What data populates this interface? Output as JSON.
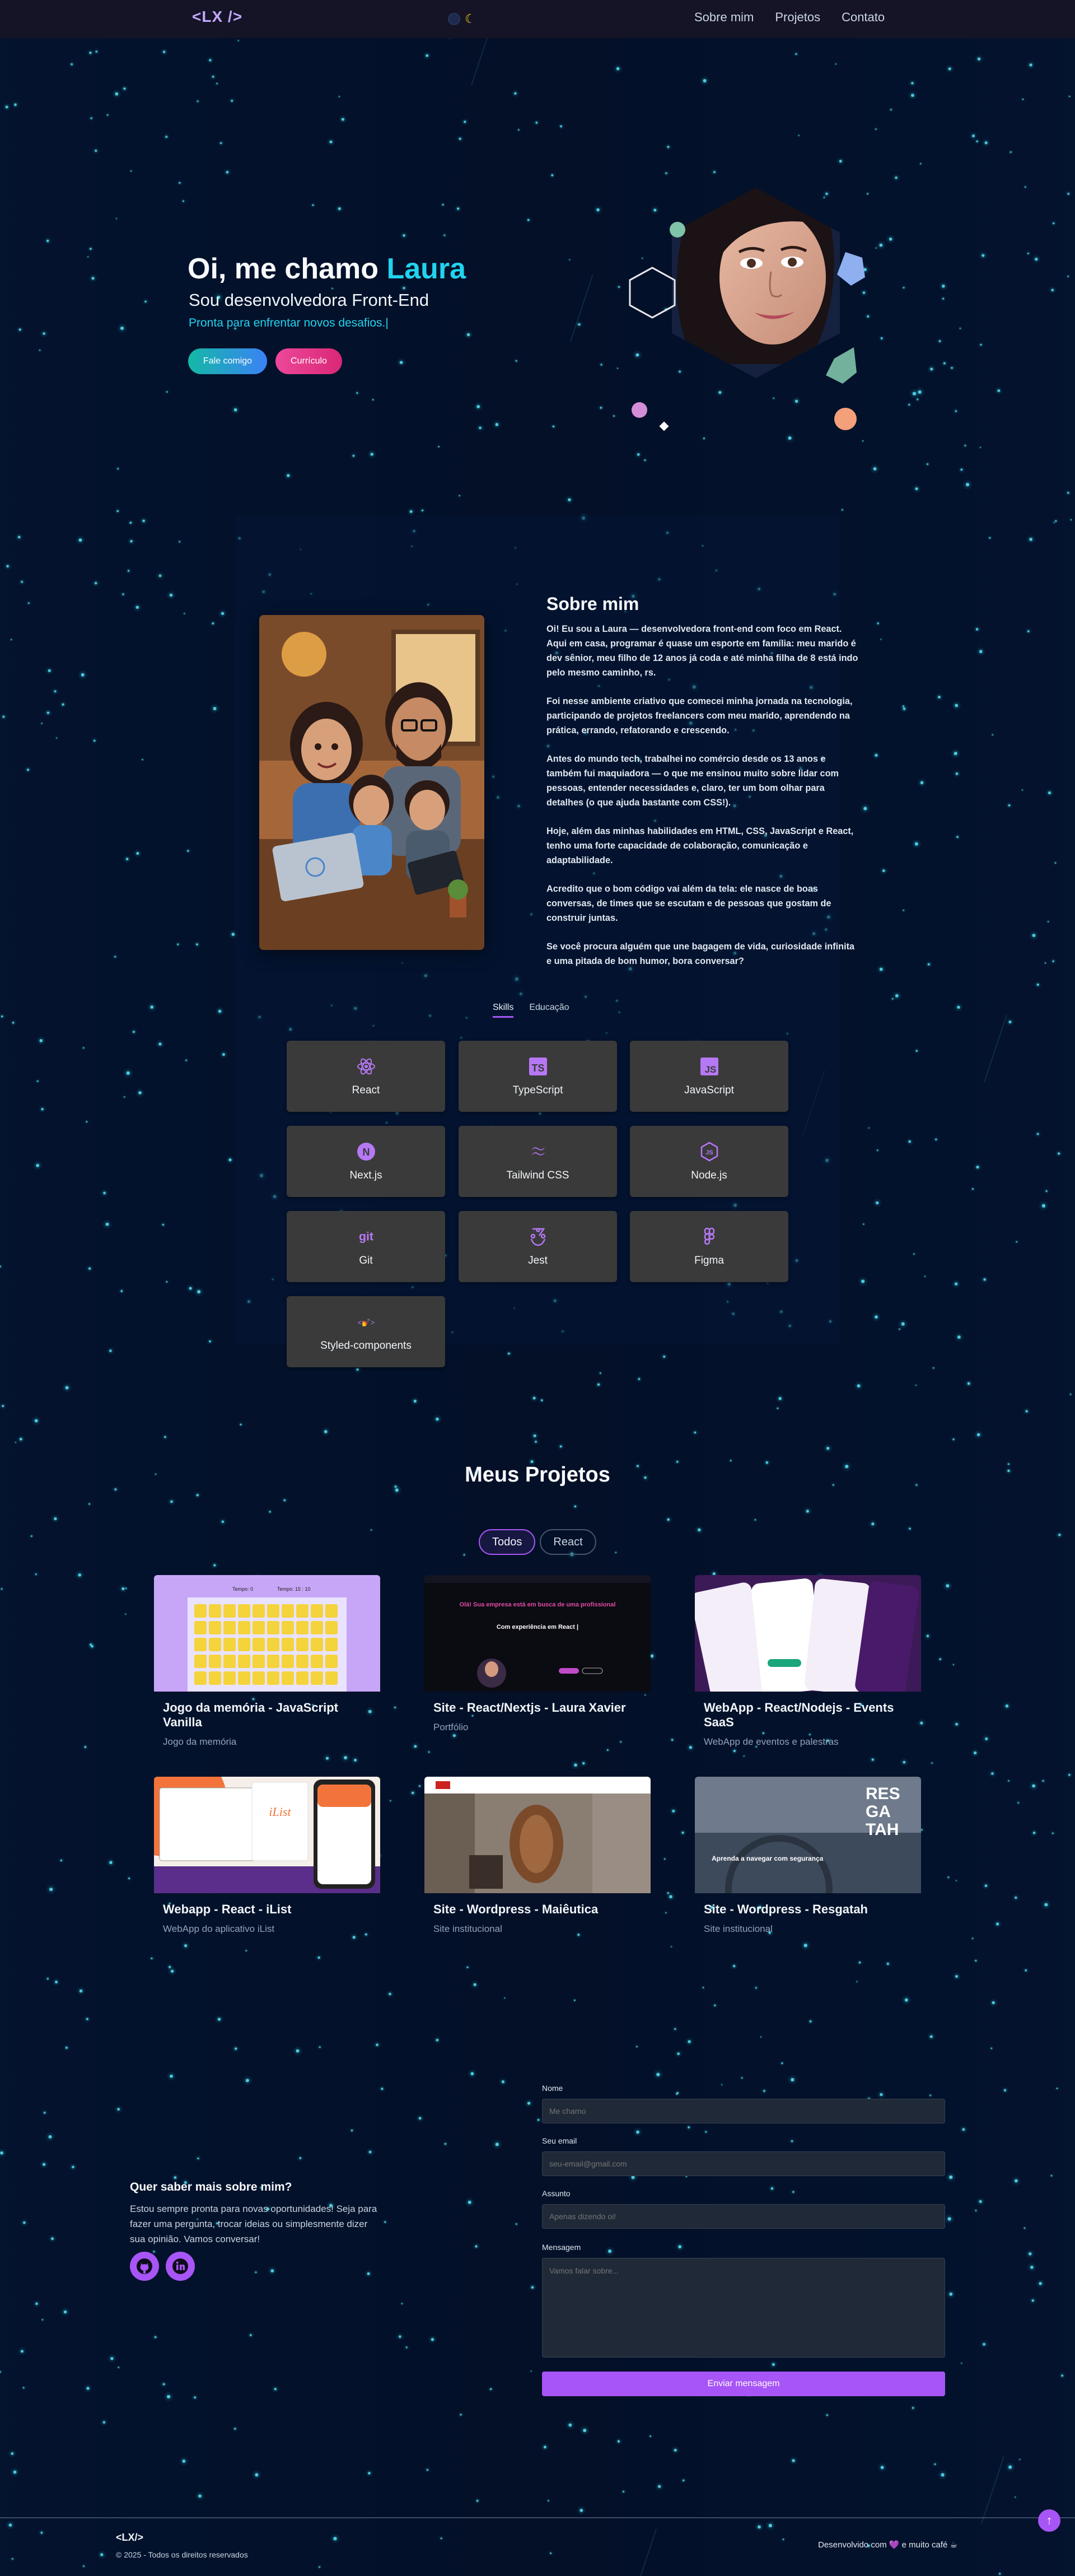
{
  "header": {
    "logo": "<LX />",
    "nav": [
      "Sobre mim",
      "Projetos",
      "Contato"
    ]
  },
  "hero": {
    "greeting": "Oi, me chamo ",
    "name": "Laura",
    "subtitle": "Sou desenvolvedora Front-End",
    "tagline": "Pronta para enfrentar novos desafios.|",
    "btn_contact": "Fale comigo",
    "btn_cv": "Currículo"
  },
  "about": {
    "title": "Sobre mim",
    "paragraphs": [
      "Oi! Eu sou a Laura — desenvolvedora front-end com foco em React. Aqui em casa, programar é quase um esporte em família: meu marido é dev sênior, meu filho de 12 anos já coda e até minha filha de 8 está indo pelo mesmo caminho, rs.",
      "Foi nesse ambiente criativo que comecei minha jornada na tecnologia, participando de projetos freelancers com meu marido, aprendendo na prática, errando, refatorando e crescendo.",
      "Antes do mundo tech, trabalhei no comércio desde os 13 anos e também fui maquiadora — o que me ensinou muito sobre lidar com pessoas, entender necessidades e, claro, ter um bom olhar para detalhes (o que ajuda bastante com CSS!).",
      "Hoje, além das minhas habilidades em HTML, CSS, JavaScript e React, tenho uma forte capacidade de colaboração, comunicação e adaptabilidade.",
      "Acredito que o bom código vai além da tela: ele nasce de boas conversas, de times que se escutam e de pessoas que gostam de construir juntas.",
      "Se você procura alguém que une bagagem de vida, curiosidade infinita e uma pitada de bom humor, bora conversar?"
    ],
    "tabs": [
      "Skills",
      "Educação"
    ],
    "skills": [
      {
        "label": "React",
        "icon": "react-icon"
      },
      {
        "label": "TypeScript",
        "icon": "typescript-icon"
      },
      {
        "label": "JavaScript",
        "icon": "javascript-icon"
      },
      {
        "label": "Next.js",
        "icon": "nextjs-icon"
      },
      {
        "label": "Tailwind CSS",
        "icon": "tailwind-icon"
      },
      {
        "label": "Node.js",
        "icon": "nodejs-icon"
      },
      {
        "label": "Git",
        "icon": "git-icon"
      },
      {
        "label": "Jest",
        "icon": "jest-icon"
      },
      {
        "label": "Figma",
        "icon": "figma-icon"
      },
      {
        "label": "Styled-components",
        "icon": "styled-components-icon"
      }
    ]
  },
  "projects": {
    "title": "Meus Projetos",
    "filters": [
      "Todos",
      "React"
    ],
    "items": [
      {
        "title": "Jogo da memória - JavaScript Vanilla",
        "subtitle": "Jogo da memória",
        "thumb_top": "Tempo: 0",
        "thumb_top2": "Tempo: 15 : 10"
      },
      {
        "title": "Site - React/Nextjs - Laura Xavier",
        "subtitle": "Portfólio",
        "thumb_line1": "Olá! Sua empresa está em busca de uma profissional",
        "thumb_line2": "Com experiência em React |"
      },
      {
        "title": "WebApp - React/Nodejs - Events SaaS",
        "subtitle": "WebApp de eventos e palestras"
      },
      {
        "title": "Webapp - React - iList",
        "subtitle": "WebApp do aplicativo iList",
        "thumb_brand": "iList"
      },
      {
        "title": "Site - Wordpress - Maiêutica",
        "subtitle": "Site institucional"
      },
      {
        "title": "Site - Wordpress - Resgatah",
        "subtitle": "Site institucional",
        "thumb_word": [
          "RES",
          "GA",
          "TAH"
        ],
        "thumb_caption": "Aprenda a navegar com segurança"
      }
    ]
  },
  "contact": {
    "heading": "Quer saber mais sobre mim?",
    "text": "Estou sempre pronta para novas oportunidades! Seja para fazer uma pergunta, trocar ideias ou simplesmente dizer sua opinião. Vamos conversar!",
    "fields": {
      "name_label": "Nome",
      "name_placeholder": "Me chamo",
      "email_label": "Seu email",
      "email_placeholder": "seu-email@gmail.com",
      "subject_label": "Assunto",
      "subject_placeholder": "Apenas dizendo oi!",
      "message_label": "Mensagem",
      "message_placeholder": "Vamos falar sobre..."
    },
    "submit": "Enviar mensagem"
  },
  "footer": {
    "logo": "<LX/>",
    "copyright": "© 2025 - Todos os direitos reservados",
    "credit": "Desenvolvido com 💜 e muito café ☕"
  },
  "colors": {
    "accent": "#a855f7",
    "cyan": "#22d3ee",
    "bg": "#03112b"
  }
}
